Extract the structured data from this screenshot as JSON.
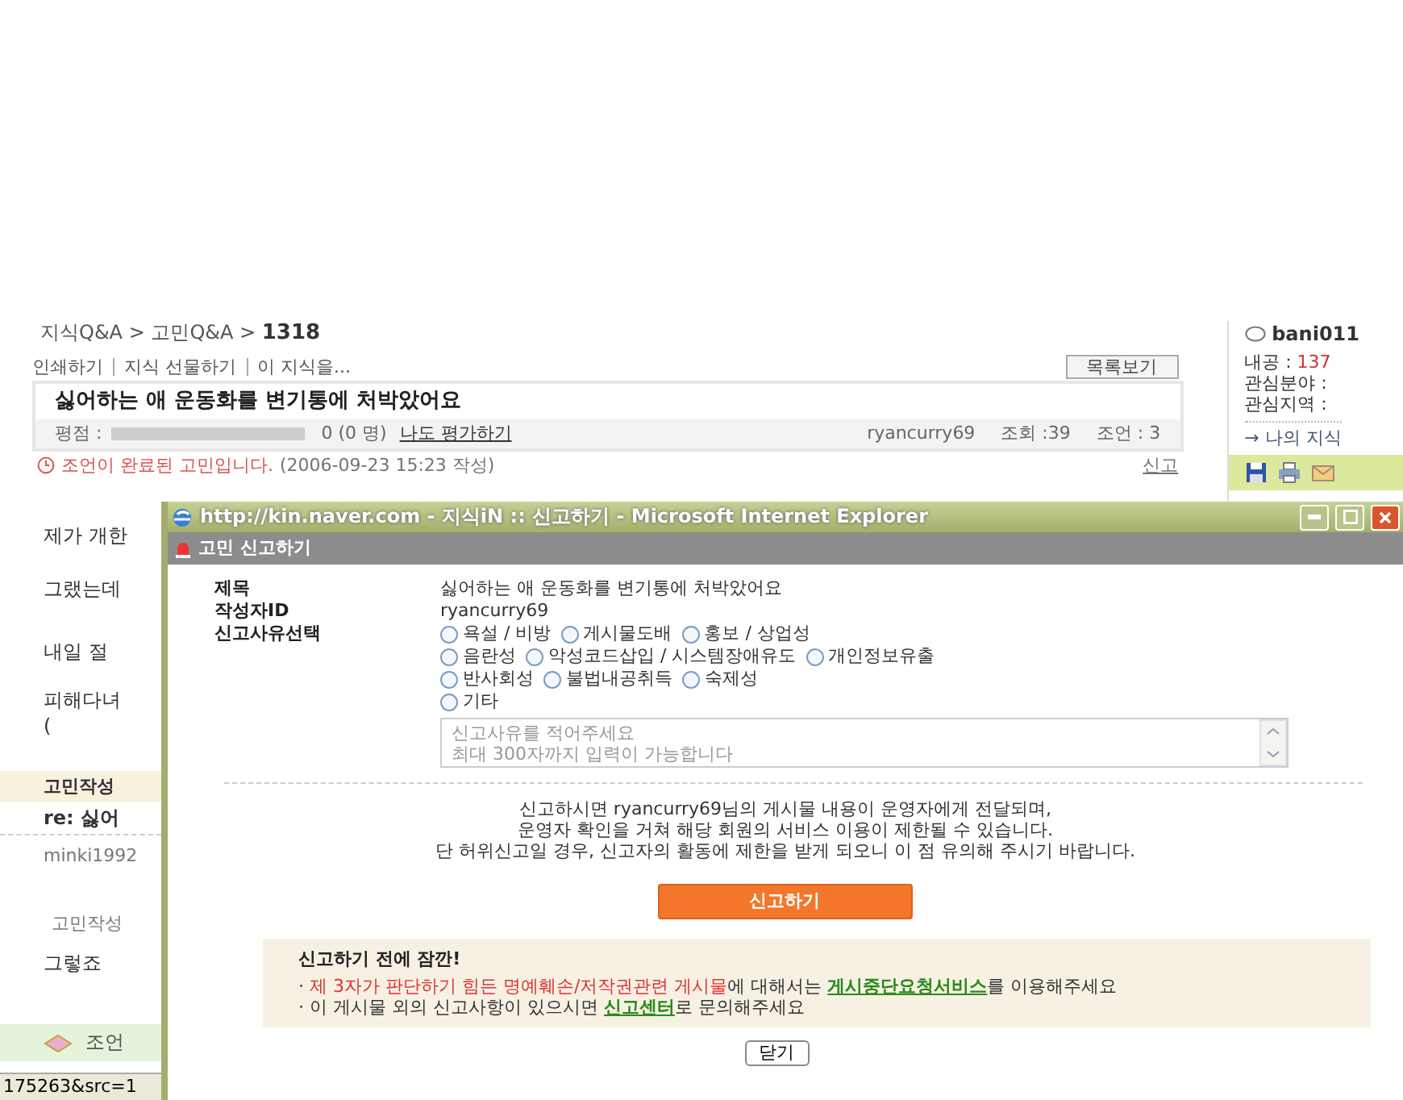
{
  "breadcrumb": "지식Q&A > 고민Q&A > **1318**",
  "actions": [
    "인쇄하기",
    "지식 선물하기",
    "이 지식을..."
  ],
  "list_button": "목록보기",
  "question": {
    "title": "싫어하는 애 운동화를 변기통에 처박았어요",
    "rating_label": "평점 :",
    "rating": {
      "level": 0
    },
    "rating_count": "0 (0 명)",
    "rate_link": "나도 평가하기",
    "author": "ryancurry69",
    "views": "조회 :39",
    "advice": "조언 : 3"
  },
  "status_line": {
    "message": "조언이 완료된 고민입니다.",
    "date": "(2006-09-23 15:23 작성)",
    "report_link": "신고"
  },
  "side_panel": {
    "user": "bani011",
    "points_label": "내공 :",
    "points": "137",
    "fields": [
      "관심분야 :",
      "관심지역 :"
    ],
    "my_link": "→ 나의 지식"
  },
  "fragments": [
    {
      "kind": "body",
      "text": "제가 개한"
    },
    {
      "kind": "body",
      "text": "그랬는데"
    },
    {
      "kind": "body",
      "text": "내일 절"
    },
    {
      "kind": "body",
      "text": "피해다녀"
    },
    {
      "kind": "body",
      "text": "("
    },
    {
      "kind": "section",
      "text": "고민작성"
    },
    {
      "kind": "reply",
      "text": "re: 싫어"
    },
    {
      "kind": "author",
      "text": "minki1992"
    },
    {
      "kind": "sublabel",
      "text": "고민작성"
    },
    {
      "kind": "body",
      "text": "그렇죠"
    },
    {
      "kind": "advice",
      "text": "조언"
    }
  ],
  "status_bar": "175263&src=1",
  "popup": {
    "window_title": "http://kin.naver.com - 지식iN :: 신고하기 - Microsoft Internet Explorer",
    "header": "고민 신고하기",
    "fields": [
      {
        "label": "제목",
        "value": "싫어하는 애 운동화를 변기통에 처박았어요"
      },
      {
        "label": "작성자ID",
        "value": "ryancurry69"
      }
    ],
    "reason_label": "신고사유선택",
    "reason_rows": [
      {
        "options": [
          {
            "label": "욕설 / 비방",
            "selected": false
          },
          {
            "label": "게시물도배",
            "selected": false
          },
          {
            "label": "홍보 / 상업성",
            "selected": false
          }
        ]
      },
      {
        "options": [
          {
            "label": "음란성",
            "selected": false
          },
          {
            "label": "악성코드삽입 / 시스템장애유도",
            "selected": false
          },
          {
            "label": "개인정보유출",
            "selected": false
          }
        ]
      },
      {
        "options": [
          {
            "label": "반사회성",
            "selected": false
          },
          {
            "label": "불법내공취득",
            "selected": false
          },
          {
            "label": "숙제성",
            "selected": false
          }
        ]
      },
      {
        "options": [
          {
            "label": "기타",
            "selected": false
          }
        ]
      }
    ],
    "reason_placeholder": "신고사유를 적어주세요\n최대 300자까지 입력이 가능합니다",
    "notice_lines": [
      "신고하시면 ryancurry69님의 게시물 내용이 운영자에게 전달되며,",
      "운영자 확인을 거쳐 해당 회원의 서비스 이용이 제한될 수 있습니다.",
      "단 허위신고일 경우, 신고자의 활동에 제한을 받게 되오니 이 점 유의해 주시기 바랍니다."
    ],
    "submit": "신고하기",
    "tips": {
      "heading": "신고하기 전에 잠깐!",
      "items": [
        {
          "bullet": "·",
          "segments": [
            {
              "kind": "warning",
              "text": "제 3자가 판단하기 힘든 명예훼손/저작권관련 게시물"
            },
            {
              "kind": "plain",
              "text": "에 대해서는 "
            },
            {
              "kind": "link",
              "text": "게시중단요청서비스"
            },
            {
              "kind": "plain",
              "text": "를 이용해주세요"
            }
          ]
        },
        {
          "bullet": "·",
          "segments": [
            {
              "kind": "plain",
              "text": "이 게시물 외의 신고사항이 있으시면 "
            },
            {
              "kind": "link",
              "text": "신고센터"
            },
            {
              "kind": "plain",
              "text": "로 문의해주세요"
            }
          ]
        }
      ]
    },
    "close": "닫기"
  }
}
